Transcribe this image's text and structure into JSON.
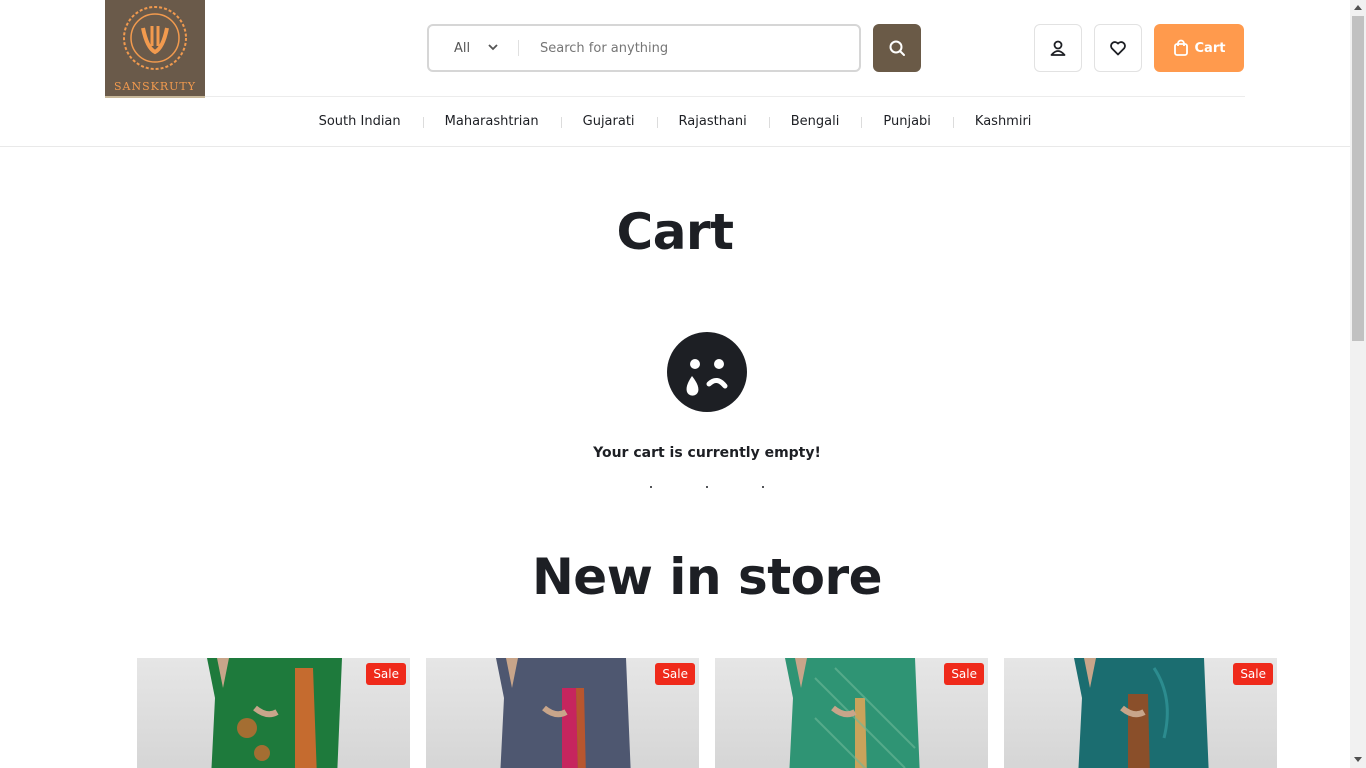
{
  "brand": {
    "logo_text": "SANSKRUTY",
    "logo_bg": "#6a5a4a",
    "logo_accent": "#f29a4e"
  },
  "search": {
    "category": "All",
    "placeholder": "Search for anything",
    "button_icon": "search-icon"
  },
  "header_actions": {
    "account_icon": "user-icon",
    "wishlist_icon": "heart-icon",
    "cart_label": "Cart",
    "cart_icon": "shopping-bag-icon",
    "cart_color": "#ff9a4d"
  },
  "nav": {
    "items": [
      {
        "label": "South Indian"
      },
      {
        "label": "Maharashtrian"
      },
      {
        "label": "Gujarati"
      },
      {
        "label": "Rajasthani"
      },
      {
        "label": "Bengali"
      },
      {
        "label": "Punjabi"
      },
      {
        "label": "Kashmiri"
      }
    ]
  },
  "main": {
    "title": "Cart",
    "empty_icon": "sad-face-icon",
    "empty_message": "Your cart is currently empty!",
    "section_title": "New in store"
  },
  "products": [
    {
      "badge": "Sale",
      "saree_color": "#1e7a3c"
    },
    {
      "badge": "Sale",
      "saree_color": "#4e5770"
    },
    {
      "badge": "Sale",
      "saree_color": "#2f9474"
    },
    {
      "badge": "Sale",
      "saree_color": "#1b6d70"
    }
  ]
}
